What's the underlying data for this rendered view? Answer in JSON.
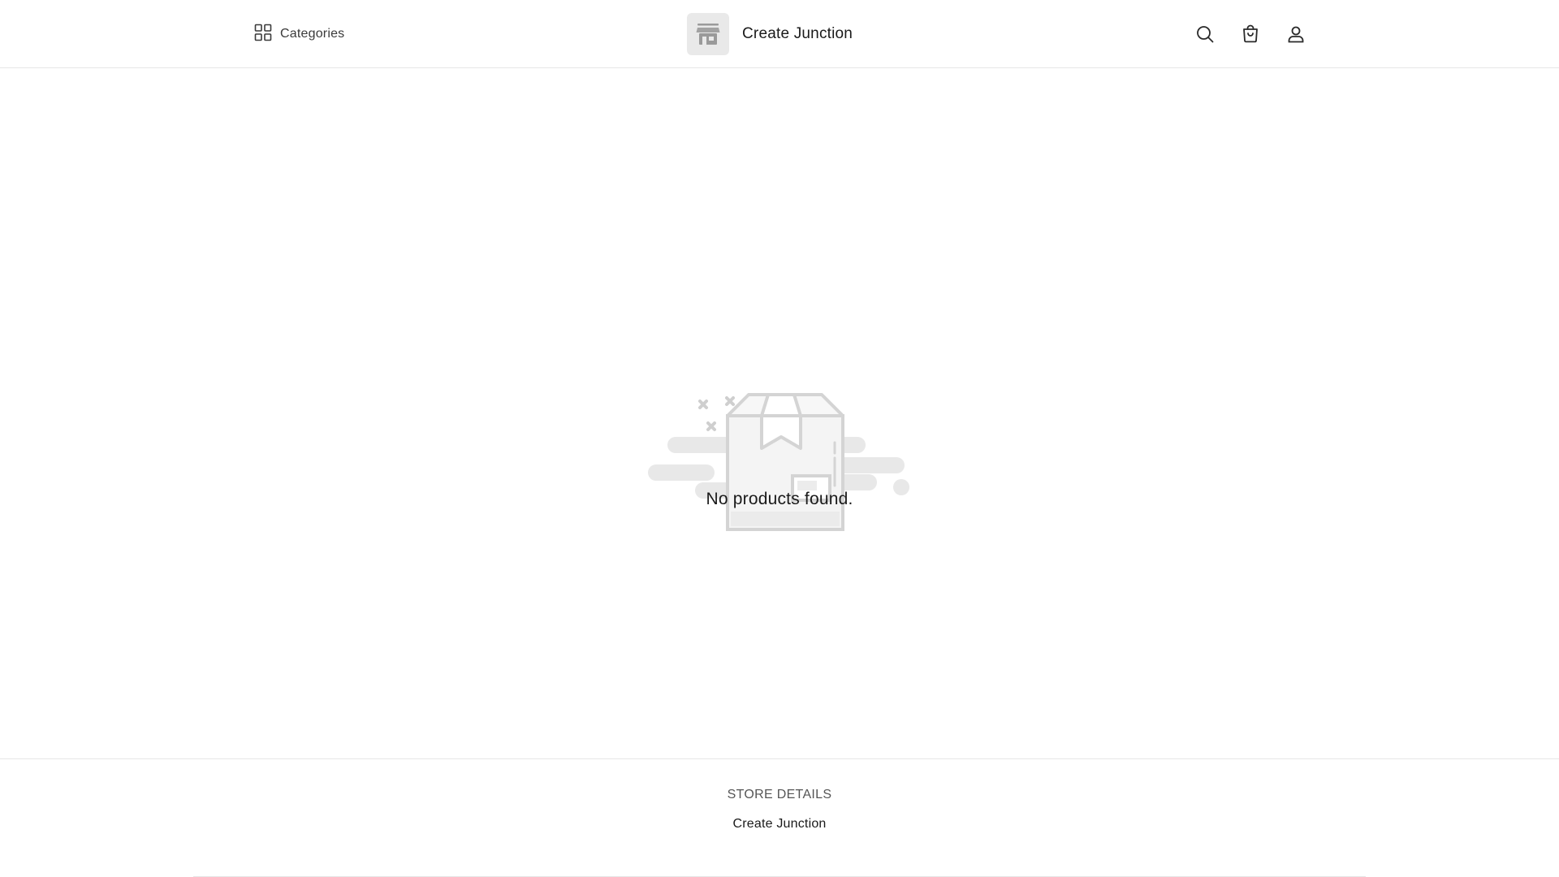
{
  "header": {
    "categories_label": "Categories",
    "categories_icon": "grid-icon",
    "store_name": "Create Junction",
    "logo_icon": "storefront-icon",
    "actions": [
      {
        "name": "search-icon"
      },
      {
        "name": "cart-icon"
      },
      {
        "name": "user-icon"
      }
    ]
  },
  "main": {
    "empty_icon": "empty-box-icon",
    "empty_message": "No products found."
  },
  "footer": {
    "heading": "STORE DETAILS",
    "store_name": "Create Junction"
  },
  "colors": {
    "text": "#1a1a1a",
    "muted": "#555555",
    "border": "#e6e6e6",
    "illustration": "#d9d9d9"
  }
}
